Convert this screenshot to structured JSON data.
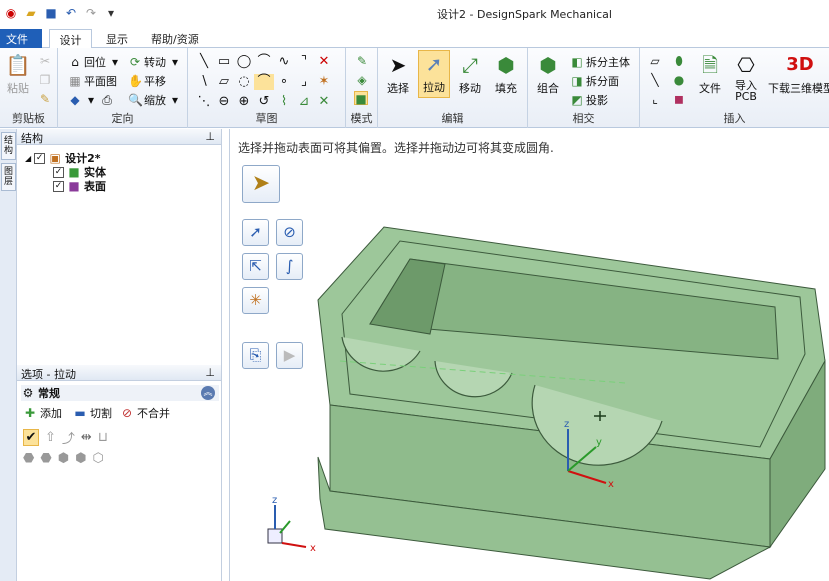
{
  "window": {
    "title": "设计2 - DesignSpark Mechanical"
  },
  "tabs": {
    "file": "文件(F)",
    "design": "设计",
    "display": "显示",
    "help": "帮助/资源"
  },
  "ribbon": {
    "clipboard": {
      "label": "剪贴板",
      "paste": "粘贴"
    },
    "orient": {
      "label": "定向",
      "home": "回位",
      "rotate": "转动",
      "plan": "平面图",
      "pan": "平移",
      "zoom": "缩放"
    },
    "sketch": {
      "label": "草图"
    },
    "mode": {
      "label": "模式"
    },
    "edit": {
      "label": "编辑",
      "select": "选择",
      "pull": "拉动",
      "move": "移动",
      "fill": "填充"
    },
    "intersect": {
      "label": "相交",
      "combine": "组合",
      "split_body": "拆分主体",
      "split_face": "拆分面",
      "project": "投影"
    },
    "insert": {
      "label": "插入",
      "file": "文件",
      "import_pcb": "导入\nPCB",
      "download_3d": "下载三维模型"
    }
  },
  "structure": {
    "title": "结构",
    "root": "设计2*",
    "items": [
      "实体",
      "表面"
    ]
  },
  "side_tabs": [
    "结构",
    "图层"
  ],
  "options": {
    "title": "选项 - 拉动",
    "section": "常规",
    "add": "添加",
    "cut": "切割",
    "no_merge": "不合并"
  },
  "viewport": {
    "hint": "选择并拖动表面可将其偏置。选择并拖动边可将其变成圆角."
  },
  "triad": {
    "x": "x",
    "y": "y",
    "z": "z"
  },
  "colors": {
    "ribbon_accent": "#1f5fb8",
    "model_green": "#9dc79a",
    "highlight": "#fce29a"
  },
  "icons": [
    "undo-icon",
    "save-icon",
    "open-icon",
    "pin-icon"
  ]
}
